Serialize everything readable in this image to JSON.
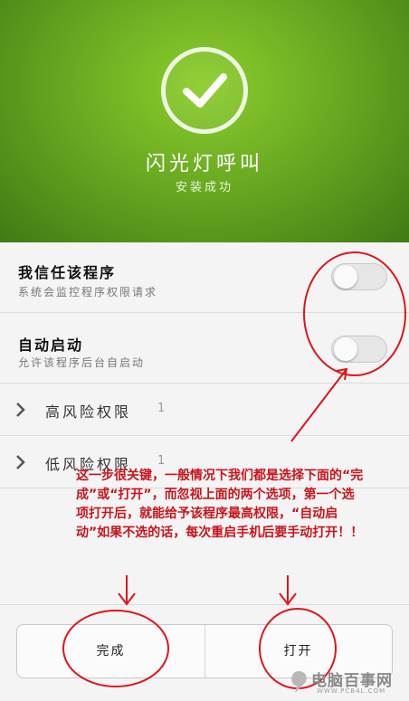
{
  "header": {
    "app_name": "闪光灯呼叫",
    "install_status": "安装成功",
    "icon": "checkmark-icon",
    "colors": {
      "primary_green": "#6aaa22"
    }
  },
  "permissions": [
    {
      "title": "我信任该程序",
      "subtitle": "系统会监控程序权限请求",
      "toggle_on": false
    },
    {
      "title": "自动启动",
      "subtitle": "允许该程序后台自启动",
      "toggle_on": false
    }
  ],
  "expandable": [
    {
      "label": "高风险权限",
      "count": "1"
    },
    {
      "label": "低风险权限",
      "count": "1"
    }
  ],
  "buttons": {
    "done": "完成",
    "open": "打开"
  },
  "annotation": {
    "text": "这一步很关键，一般情况下我们都是选择下面的“完成”或“打开”，而忽视上面的两个选项，第一个选项打开后，就能给予该程序最高权限，“自动启动”如果不选的话，每次重启手机后要手动打开！！",
    "color": "#c8141c"
  },
  "watermark": {
    "main": "电脑百事网",
    "sub": "WWW.PCB4L.COM"
  }
}
